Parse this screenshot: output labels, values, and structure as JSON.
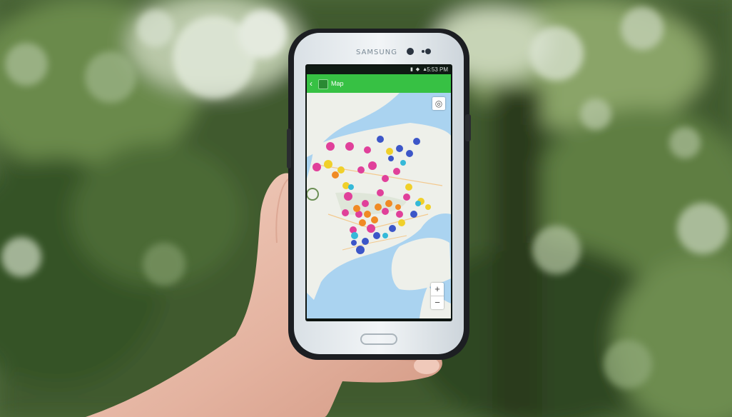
{
  "photo": {
    "subject": "hand holding smartphone",
    "phone": {
      "brand_label": "SAMSUNG",
      "status_time": "5:53 PM",
      "app_title": "Map",
      "icons": {
        "back": "back-arrow-icon",
        "app_logo": "app-logo-icon",
        "locate": "locate-me-icon",
        "zoom_in": "zoom-in-icon",
        "zoom_out": "zoom-out-icon",
        "home": "home-button"
      },
      "colors": {
        "app_bar": "#37c144",
        "water": "#aad3f0",
        "land": "#eef0ea",
        "marker_pink": "#e0409a",
        "marker_blue": "#3c56c8",
        "marker_yellow": "#f0d02a",
        "marker_orange": "#f08a24",
        "marker_cyan": "#35b9d8"
      },
      "zoom_in_label": "+",
      "zoom_out_label": "−"
    }
  }
}
